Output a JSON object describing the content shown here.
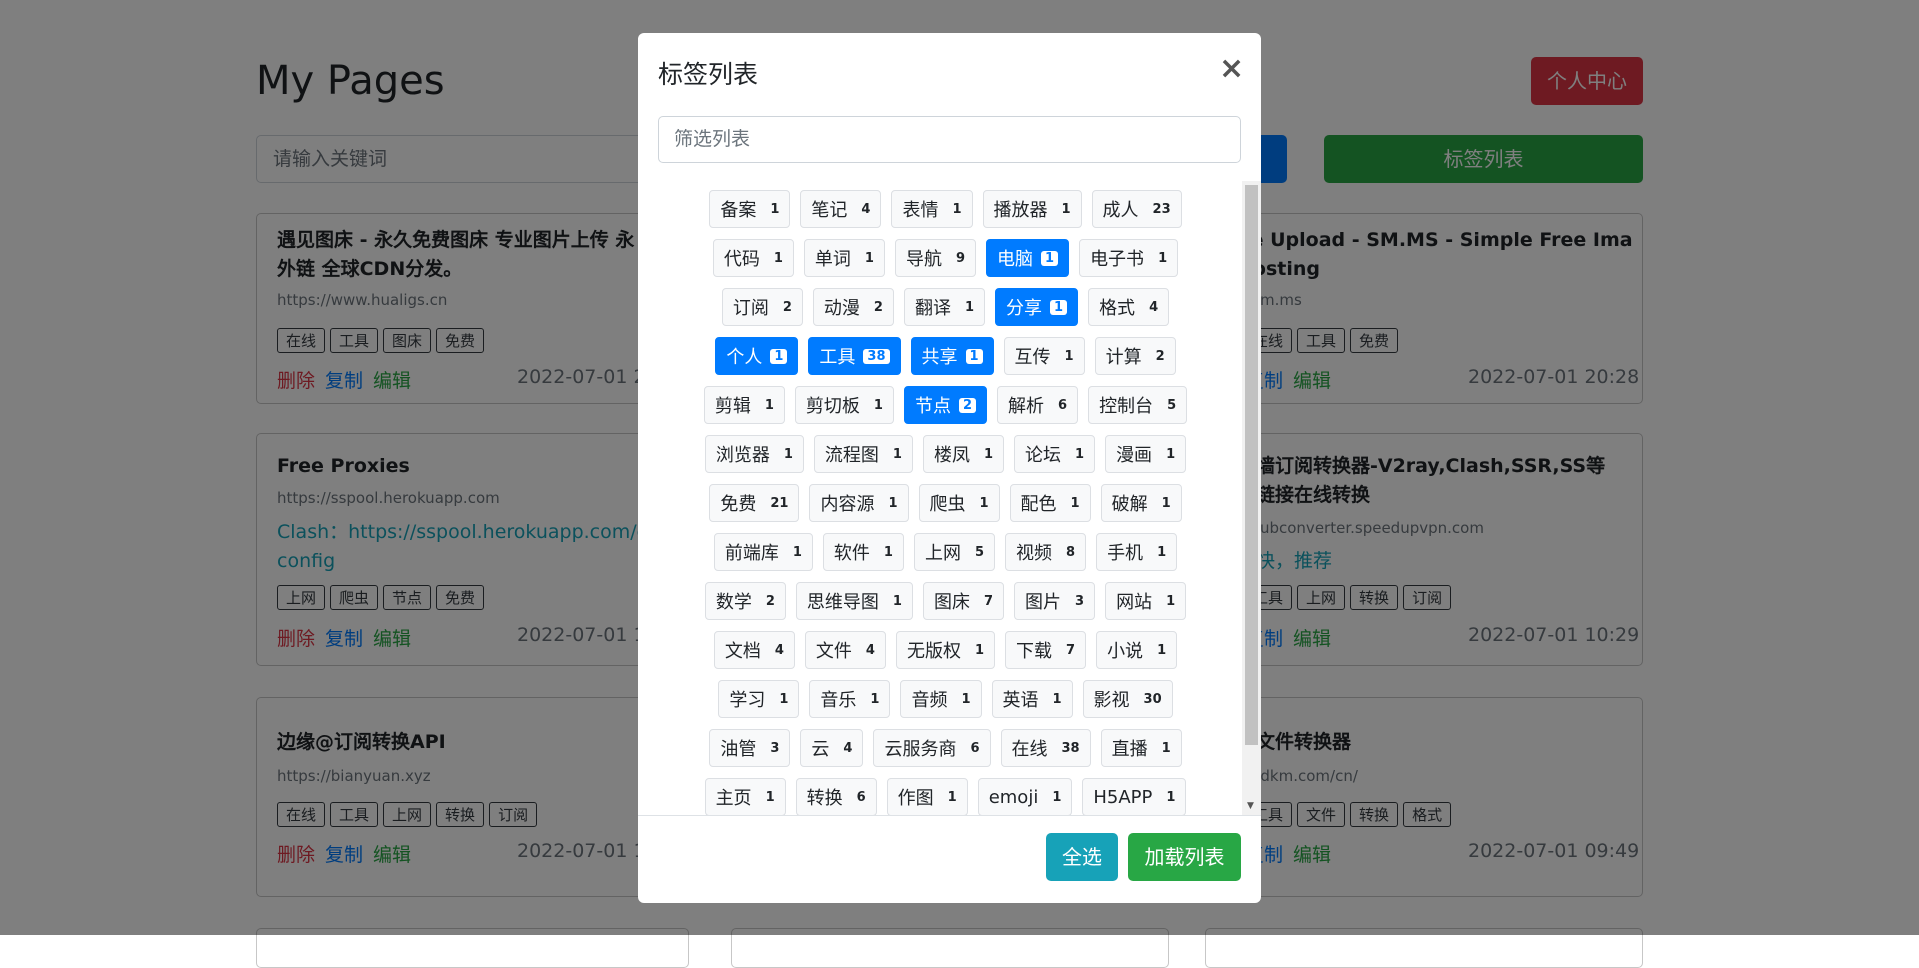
{
  "page": {
    "title": "My Pages",
    "user_center": "个人中心",
    "search_placeholder": "请输入关键词",
    "tags_button": "标签列表"
  },
  "cards": [
    {
      "title": "遇见图床 - 永久免费图床 专业图片上传 永\n外链 全球CDN分发。",
      "url": "https://www.hualigs.cn",
      "note": "",
      "tags": [
        "在线",
        "工具",
        "图床",
        "免费"
      ],
      "date": "2022-07-01 20"
    },
    {
      "title": "ge Upload - SM.MS - Simple Free Ima\nHosting",
      "url": "://sm.ms",
      "note": "",
      "tags": [
        "床",
        "在线",
        "工具",
        "免费"
      ],
      "date": "2022-07-01 20:28"
    },
    {
      "title": "Free Proxies",
      "url": "https://sspool.herokuapp.com",
      "note": "Clash：https://sspool.herokuapp.com/cla\nconfig",
      "tags": [
        "上网",
        "爬虫",
        "节点",
        "免费"
      ],
      "date": "2022-07-01 18"
    },
    {
      "title": "翻墙订阅转换器-V2ray,Clash,SSR,SS等\n阅链接在线转换",
      "url": "://subconverter.speedupvpn.com",
      "note": "很快，推荐",
      "tags": [
        "线",
        "工具",
        "上网",
        "转换",
        "订阅"
      ],
      "date": "2022-07-01 10:29"
    },
    {
      "title": "边缘@订阅转换API",
      "url": "https://bianyuan.xyz",
      "note": "",
      "tags": [
        "在线",
        "工具",
        "上网",
        "转换",
        "订阅"
      ],
      "date": "2022-07-01 10"
    },
    {
      "title": "线文件转换器",
      "url": "://cdkm.com/cn/",
      "note": "",
      "tags": [
        "线",
        "工具",
        "文件",
        "转换",
        "格式"
      ],
      "date": "2022-07-01 09:49"
    }
  ],
  "actions": {
    "delete": "删除",
    "copy": "复制",
    "edit": "编辑",
    "delete_partial": "余"
  },
  "modal": {
    "title": "标签列表",
    "close": "×",
    "filter_placeholder": "筛选列表",
    "select_all": "全选",
    "load_list": "加载列表",
    "tags": [
      {
        "name": "备案",
        "count": "1",
        "selected": false
      },
      {
        "name": "笔记",
        "count": "4",
        "selected": false
      },
      {
        "name": "表情",
        "count": "1",
        "selected": false
      },
      {
        "name": "播放器",
        "count": "1",
        "selected": false
      },
      {
        "name": "成人",
        "count": "23",
        "selected": false
      },
      {
        "name": "代码",
        "count": "1",
        "selected": false
      },
      {
        "name": "单词",
        "count": "1",
        "selected": false
      },
      {
        "name": "导航",
        "count": "9",
        "selected": false
      },
      {
        "name": "电脑",
        "count": "1",
        "selected": true
      },
      {
        "name": "电子书",
        "count": "1",
        "selected": false
      },
      {
        "name": "订阅",
        "count": "2",
        "selected": false
      },
      {
        "name": "动漫",
        "count": "2",
        "selected": false
      },
      {
        "name": "翻译",
        "count": "1",
        "selected": false
      },
      {
        "name": "分享",
        "count": "1",
        "selected": true
      },
      {
        "name": "格式",
        "count": "4",
        "selected": false
      },
      {
        "name": "个人",
        "count": "1",
        "selected": true
      },
      {
        "name": "工具",
        "count": "38",
        "selected": true
      },
      {
        "name": "共享",
        "count": "1",
        "selected": true
      },
      {
        "name": "互传",
        "count": "1",
        "selected": false
      },
      {
        "name": "计算",
        "count": "2",
        "selected": false
      },
      {
        "name": "剪辑",
        "count": "1",
        "selected": false
      },
      {
        "name": "剪切板",
        "count": "1",
        "selected": false
      },
      {
        "name": "节点",
        "count": "2",
        "selected": true
      },
      {
        "name": "解析",
        "count": "6",
        "selected": false
      },
      {
        "name": "控制台",
        "count": "5",
        "selected": false
      },
      {
        "name": "浏览器",
        "count": "1",
        "selected": false
      },
      {
        "name": "流程图",
        "count": "1",
        "selected": false
      },
      {
        "name": "楼凤",
        "count": "1",
        "selected": false
      },
      {
        "name": "论坛",
        "count": "1",
        "selected": false
      },
      {
        "name": "漫画",
        "count": "1",
        "selected": false
      },
      {
        "name": "免费",
        "count": "21",
        "selected": false
      },
      {
        "name": "内容源",
        "count": "1",
        "selected": false
      },
      {
        "name": "爬虫",
        "count": "1",
        "selected": false
      },
      {
        "name": "配色",
        "count": "1",
        "selected": false
      },
      {
        "name": "破解",
        "count": "1",
        "selected": false
      },
      {
        "name": "前端库",
        "count": "1",
        "selected": false
      },
      {
        "name": "软件",
        "count": "1",
        "selected": false
      },
      {
        "name": "上网",
        "count": "5",
        "selected": false
      },
      {
        "name": "视频",
        "count": "8",
        "selected": false
      },
      {
        "name": "手机",
        "count": "1",
        "selected": false
      },
      {
        "name": "数学",
        "count": "2",
        "selected": false
      },
      {
        "name": "思维导图",
        "count": "1",
        "selected": false
      },
      {
        "name": "图床",
        "count": "7",
        "selected": false
      },
      {
        "name": "图片",
        "count": "3",
        "selected": false
      },
      {
        "name": "网站",
        "count": "1",
        "selected": false
      },
      {
        "name": "文档",
        "count": "4",
        "selected": false
      },
      {
        "name": "文件",
        "count": "4",
        "selected": false
      },
      {
        "name": "无版权",
        "count": "1",
        "selected": false
      },
      {
        "name": "下载",
        "count": "7",
        "selected": false
      },
      {
        "name": "小说",
        "count": "1",
        "selected": false
      },
      {
        "name": "学习",
        "count": "1",
        "selected": false
      },
      {
        "name": "音乐",
        "count": "1",
        "selected": false
      },
      {
        "name": "音频",
        "count": "1",
        "selected": false
      },
      {
        "name": "英语",
        "count": "1",
        "selected": false
      },
      {
        "name": "影视",
        "count": "30",
        "selected": false
      },
      {
        "name": "油管",
        "count": "3",
        "selected": false
      },
      {
        "name": "云",
        "count": "4",
        "selected": false
      },
      {
        "name": "云服务商",
        "count": "6",
        "selected": false
      },
      {
        "name": "在线",
        "count": "38",
        "selected": false
      },
      {
        "name": "直播",
        "count": "1",
        "selected": false
      },
      {
        "name": "主页",
        "count": "1",
        "selected": false
      },
      {
        "name": "转换",
        "count": "6",
        "selected": false
      },
      {
        "name": "作图",
        "count": "1",
        "selected": false
      },
      {
        "name": "emoji",
        "count": "1",
        "selected": false
      },
      {
        "name": "H5APP",
        "count": "1",
        "selected": false
      }
    ]
  },
  "colors": {
    "primary": "#007bff",
    "success": "#28a745",
    "danger": "#dc3545",
    "info": "#17a2b8"
  },
  "icons": {
    "close": "close-icon"
  }
}
